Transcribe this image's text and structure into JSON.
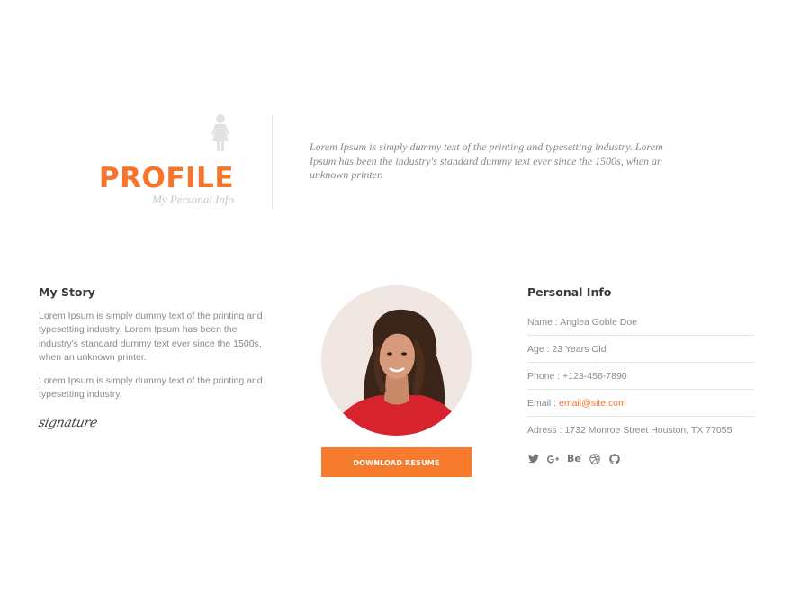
{
  "header": {
    "icon": "person-female-icon",
    "title": "PROFILE",
    "subtitle": "My Personal Info",
    "intro": "Lorem Ipsum is simply dummy text of the printing and typesetting industry. Lorem Ipsum has been the industry's standard dummy text ever since the 1500s, when an unknown printer."
  },
  "story": {
    "heading": "My Story",
    "paragraphs": [
      "Lorem Ipsum is simply dummy text of the printing and typesetting industry. Lorem Ipsum has been the industry's standard dummy text ever since the 1500s, when an unknown printer.",
      "Lorem Ipsum is simply dummy text of the printing and typesetting industry."
    ],
    "signature": "signature"
  },
  "photo": {
    "icon": "profile-photo",
    "download_label": "DOWNLOAD RESUME"
  },
  "info": {
    "heading": "Personal Info",
    "name_label": "Name :",
    "name": "Anglea Goble Doe",
    "age_label": "Age :",
    "age": "23 Years Old",
    "phone_label": "Phone :",
    "phone": "+123-456-7890",
    "email_label": "Email :",
    "email": "email@site.com",
    "address_label": "Adress :",
    "address": "1732 Monroe Street Houston, TX 77055"
  },
  "social": {
    "icons": [
      "twitter-icon",
      "google-plus-icon",
      "behance-icon",
      "dribbble-icon",
      "github-icon"
    ],
    "behance_text": "Bē"
  },
  "colors": {
    "accent": "#f7742c",
    "button": "#f77b2d",
    "photo_bg": "#f0e6e2"
  }
}
